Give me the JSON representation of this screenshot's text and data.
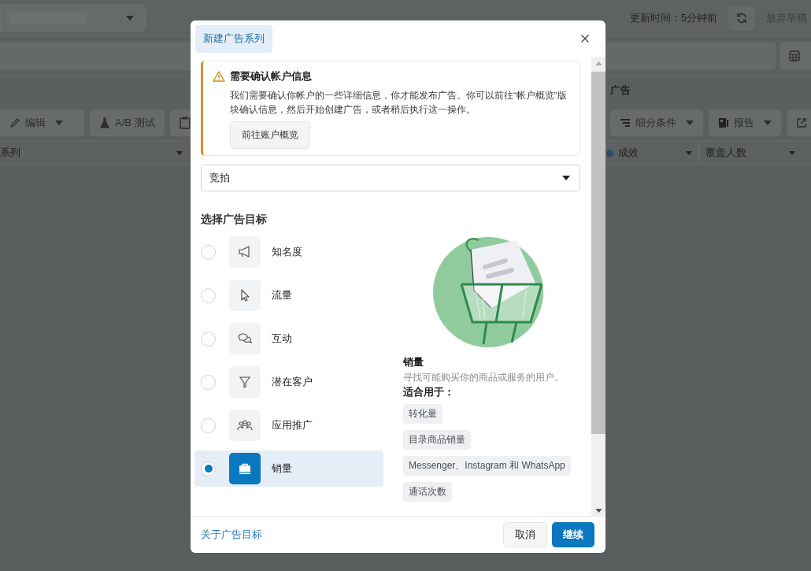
{
  "page": {
    "update_time": "更新时间：5分钟前",
    "discard_draft": "放弃草稿",
    "section_title": "广告",
    "toolbar_left": [
      {
        "label": "编辑",
        "kind": "edit"
      },
      {
        "label": "A/B 测试",
        "kind": "test"
      }
    ],
    "toolbar_right": [
      {
        "label": "细分条件",
        "kind": "breakdown"
      },
      {
        "label": "报告",
        "kind": "report"
      }
    ],
    "column_left": "系列",
    "columns_right": [
      {
        "label": "成效",
        "info": true
      },
      {
        "label": "覆盖人数",
        "info": false
      }
    ]
  },
  "dialog": {
    "title": "新建广告系列",
    "notice": {
      "title": "需要确认帐户信息",
      "text": "我们需要确认你帐户的一些详细信息，你才能发布广告。你可以前往“帐户概览”版块确认信息，然后开始创建广告，或者稍后执行这一操作。",
      "button": "前往账户概览"
    },
    "buying_type": "竞拍",
    "objective_heading": "选择广告目标",
    "objectives": [
      {
        "label": "知名度",
        "kind": "awareness",
        "selected": false
      },
      {
        "label": "流量",
        "kind": "traffic",
        "selected": false
      },
      {
        "label": "互动",
        "kind": "engagement",
        "selected": false
      },
      {
        "label": "潜在客户",
        "kind": "leads",
        "selected": false
      },
      {
        "label": "应用推广",
        "kind": "app",
        "selected": false
      },
      {
        "label": "销量",
        "kind": "sales",
        "selected": true
      }
    ],
    "detail": {
      "title": "销量",
      "description": "寻找可能购买你的商品或服务的用户。",
      "good_for_label": "适合用于：",
      "good_for": [
        "转化量",
        "目录商品销量",
        "Messenger、Instagram 和 WhatsApp",
        "通话次数"
      ]
    },
    "footer_link": "关于广告目标",
    "buttons": [
      {
        "label": "取消",
        "kind": "secondary"
      },
      {
        "label": "继续",
        "kind": "primary"
      }
    ]
  }
}
